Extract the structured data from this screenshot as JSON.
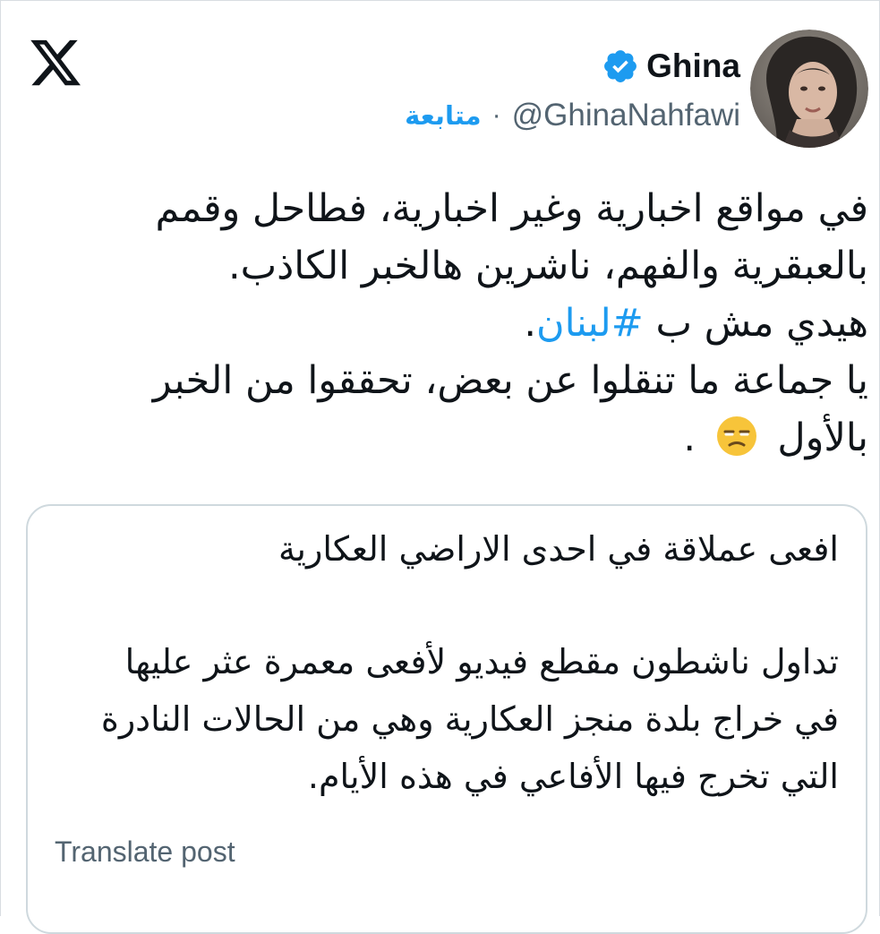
{
  "author": {
    "display_name": "Ghina",
    "handle": "@GhinaNahfawi",
    "separator": "·",
    "follow_label": "متابعة",
    "verified": true
  },
  "tweet": {
    "line1": "في مواقع اخبارية وغير اخبارية، فطاحل وقمم",
    "line2": "بالعبقرية والفهم، ناشرين هالخبر الكاذب.",
    "line3_before": "هيدي مش ب ",
    "hashtag": "#لبنان",
    "line3_after": ".",
    "line4": "يا جماعة ما تنقلوا عن بعض،  تحققوا من الخبر",
    "line5_before": "بالأول ",
    "line5_after": " .",
    "emoji": "unamused-face"
  },
  "quote": {
    "title": "افعى عملاقة في احدى الاراضي العكارية",
    "body": [
      "تداول ناشطون مقطع فيديو لأفعى معمرة عثر عليها",
      "في خراج بلدة منجز العكارية وهي من الحالات النادرة",
      "التي تخرج فيها الأفاعي في هذه الأيام."
    ]
  },
  "translate_label": "Translate post",
  "icons": {
    "logo": "x-logo-icon",
    "badge": "verified-badge-icon"
  },
  "colors": {
    "accent": "#1d9bf0",
    "text": "#0f1419",
    "secondary": "#536471",
    "border": "#cfd9de"
  }
}
